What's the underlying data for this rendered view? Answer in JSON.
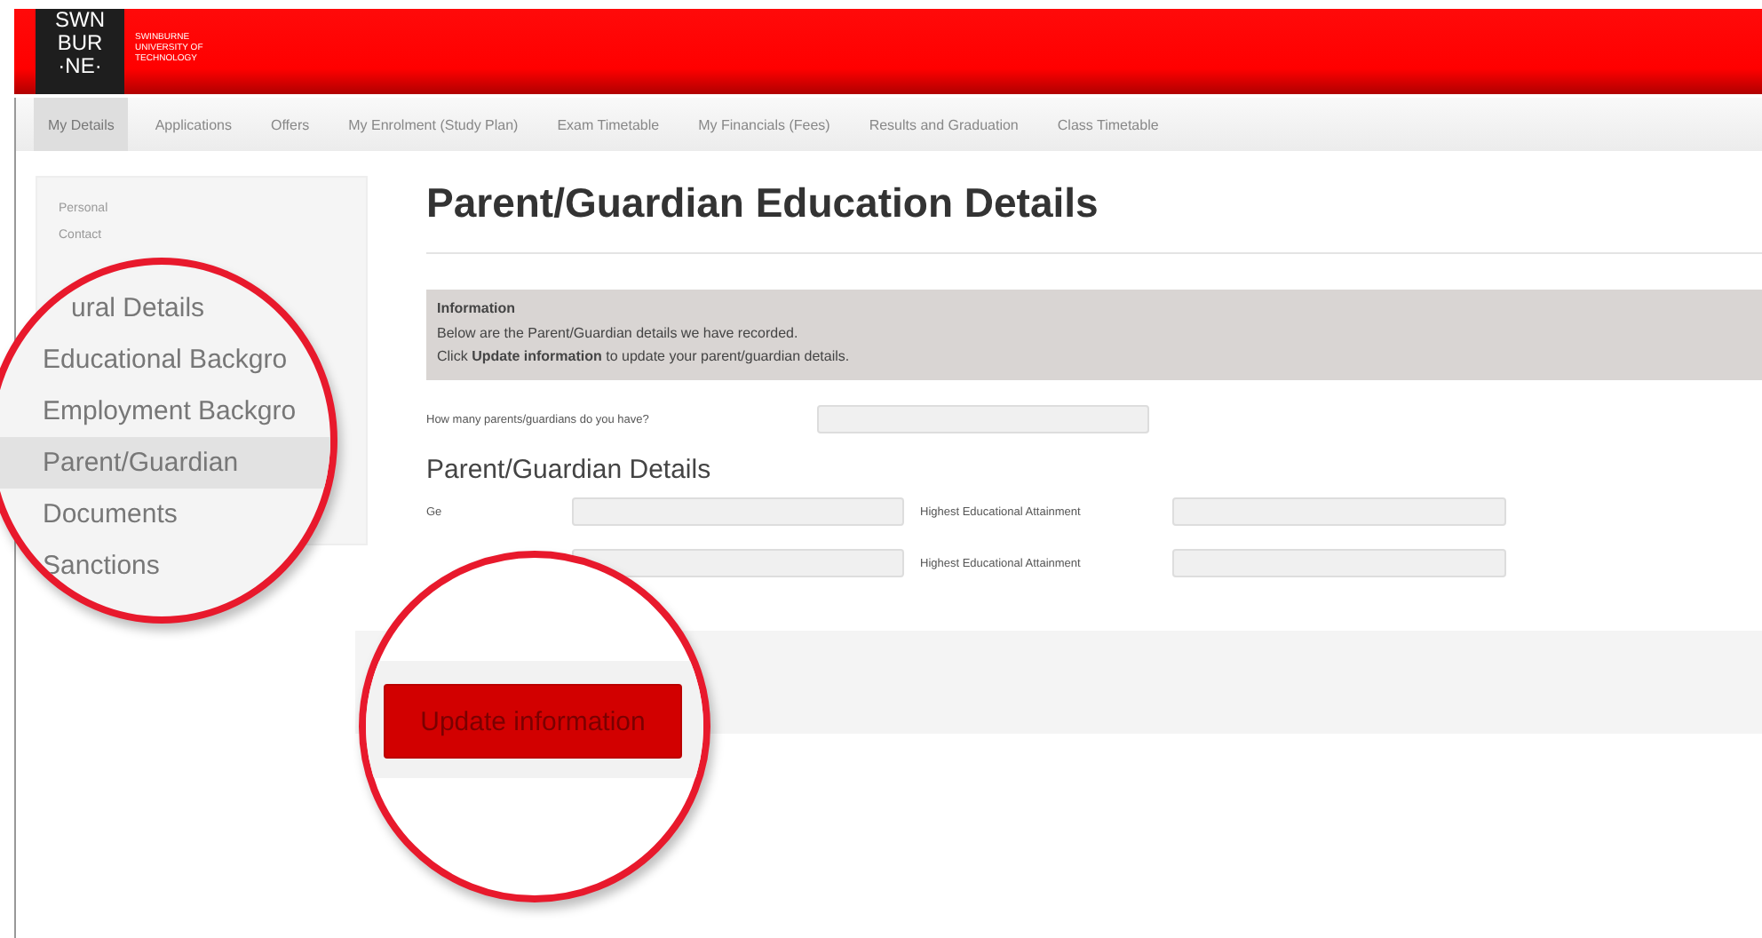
{
  "header": {
    "logo": [
      "SWN",
      "BUR",
      "·NE·"
    ],
    "institution": [
      "SWINBURNE",
      "UNIVERSITY OF",
      "TECHNOLOGY"
    ]
  },
  "nav": [
    {
      "label": "My Details",
      "selected": true
    },
    {
      "label": "Applications",
      "selected": false
    },
    {
      "label": "Offers",
      "selected": false
    },
    {
      "label": "My Enrolment (Study Plan)",
      "selected": false
    },
    {
      "label": "Exam Timetable",
      "selected": false
    },
    {
      "label": "My Financials (Fees)",
      "selected": false
    },
    {
      "label": "Results and Graduation",
      "selected": false
    },
    {
      "label": "Class Timetable",
      "selected": false
    }
  ],
  "sidebar": {
    "items": [
      {
        "label": "Personal"
      },
      {
        "label": "Contact"
      }
    ]
  },
  "magnified_sidebar": {
    "items": [
      {
        "label": "ural Details",
        "selected": false
      },
      {
        "label": "Educational Backgro",
        "selected": false
      },
      {
        "label": "Employment Backgro",
        "selected": false
      },
      {
        "label": "Parent/Guardian",
        "selected": true
      },
      {
        "label": "Documents",
        "selected": false
      },
      {
        "label": "Sanctions",
        "selected": false
      }
    ]
  },
  "main": {
    "title": "Parent/Guardian Education Details",
    "info": {
      "heading": "Information",
      "lines": [
        "Below are the Parent/Guardian details we have recorded.",
        "Click **Update information** to update your parent/guardian details."
      ]
    },
    "question": {
      "label": "How many parents/guardians do you have?"
    },
    "section_title": "Parent/Guardian Details",
    "rows": [
      {
        "label": "Ge",
        "attainment_label": "Highest Educational Attainment"
      },
      {
        "attainment_label": "Highest Educational Attainment"
      }
    ]
  },
  "button": {
    "label": "Update information"
  }
}
